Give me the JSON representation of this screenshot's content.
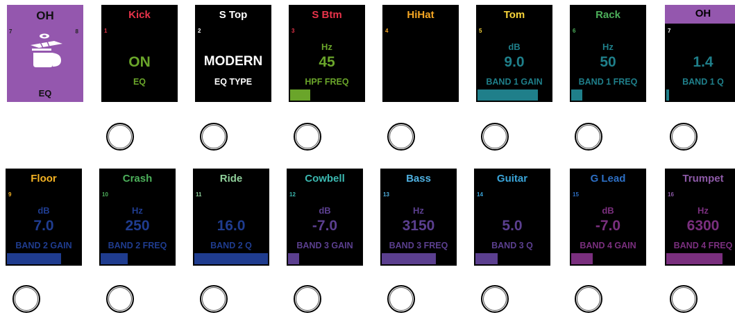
{
  "top_row": {
    "oh_tile": {
      "title": "OH",
      "num_left": "7",
      "num_right": "8",
      "label": "EQ",
      "icon": "hi-hat-cymbal-icon",
      "bg": "#9457ae"
    },
    "screens": [
      {
        "name": "Kick",
        "num": "1",
        "unit": "",
        "value": "ON",
        "param": "EQ",
        "name_color": "#e8334a",
        "num_color": "#e8334a",
        "accent": "#6aa52a",
        "fill": 0
      },
      {
        "name": "S Top",
        "num": "2",
        "unit": "",
        "value": "MODERN",
        "param": "EQ TYPE",
        "name_color": "#ffffff",
        "num_color": "#ffffff",
        "accent": "#ffffff",
        "fill": 0
      },
      {
        "name": "S Btm",
        "num": "3",
        "unit": "Hz",
        "value": "45",
        "param": "HPF FREQ",
        "name_color": "#e8334a",
        "num_color": "#e8334a",
        "accent": "#6aa52a",
        "fill": 0.27
      },
      {
        "name": "HiHat",
        "num": "4",
        "unit": "",
        "value": "",
        "param": "",
        "name_color": "#f5a623",
        "num_color": "#f5a623",
        "accent": "#f5a623",
        "fill": 0
      },
      {
        "name": "Tom",
        "num": "5",
        "unit": "dB",
        "value": "9.0",
        "param": "BAND 1 GAIN",
        "name_color": "#f7d43a",
        "num_color": "#f7d43a",
        "accent": "#1f7f8a",
        "fill": 0.82
      },
      {
        "name": "Rack",
        "num": "6",
        "unit": "Hz",
        "value": "50",
        "param": "BAND 1 FREQ",
        "name_color": "#4caf5a",
        "num_color": "#4caf5a",
        "accent": "#1f7f8a",
        "fill": 0.15
      },
      {
        "name": "OH",
        "num": "7",
        "unit": "",
        "value": "1.4",
        "param": "BAND 1 Q",
        "name_color": "#000000",
        "num_color": "#ffffff",
        "accent": "#1f7f8a",
        "fill": 0.04
      }
    ]
  },
  "bottom_row": {
    "screens": [
      {
        "name": "Floor",
        "num": "9",
        "unit": "dB",
        "value": "7.0",
        "param": "BAND 2 GAIN",
        "name_color": "#f5b323",
        "num_color": "#f5b323",
        "accent": "#1f3c8f",
        "fill": 0.74
      },
      {
        "name": "Crash",
        "num": "10",
        "unit": "Hz",
        "value": "250",
        "param": "BAND 2 FREQ",
        "name_color": "#4caf5a",
        "num_color": "#4caf5a",
        "accent": "#1f3c8f",
        "fill": 0.37
      },
      {
        "name": "Ride",
        "num": "11",
        "unit": "",
        "value": "16.0",
        "param": "BAND 2 Q",
        "name_color": "#8fcf9a",
        "num_color": "#8fcf9a",
        "accent": "#1f3c8f",
        "fill": 1.0
      },
      {
        "name": "Cowbell",
        "num": "12",
        "unit": "dB",
        "value": "-7.0",
        "param": "BAND 3 GAIN",
        "name_color": "#3bb8b0",
        "num_color": "#3bb8b0",
        "accent": "#5b3f8f",
        "fill": 0.15
      },
      {
        "name": "Bass",
        "num": "13",
        "unit": "Hz",
        "value": "3150",
        "param": "BAND 3 FREQ",
        "name_color": "#4fb0e0",
        "num_color": "#4fb0e0",
        "accent": "#5b3f8f",
        "fill": 0.74
      },
      {
        "name": "Guitar",
        "num": "14",
        "unit": "",
        "value": "5.0",
        "param": "BAND 3 Q",
        "name_color": "#3aa4d8",
        "num_color": "#3aa4d8",
        "accent": "#5b3f8f",
        "fill": 0.3
      },
      {
        "name": "G Lead",
        "num": "15",
        "unit": "dB",
        "value": "-7.0",
        "param": "BAND 4 GAIN",
        "name_color": "#2d6fc4",
        "num_color": "#2d6fc4",
        "accent": "#7a2f7e",
        "fill": 0.29
      },
      {
        "name": "Trumpet",
        "num": "16",
        "unit": "Hz",
        "value": "6300",
        "param": "BAND 4 FREQ",
        "name_color": "#8e5aa8",
        "num_color": "#8e5aa8",
        "accent": "#7a2f7e",
        "fill": 0.76
      }
    ]
  }
}
